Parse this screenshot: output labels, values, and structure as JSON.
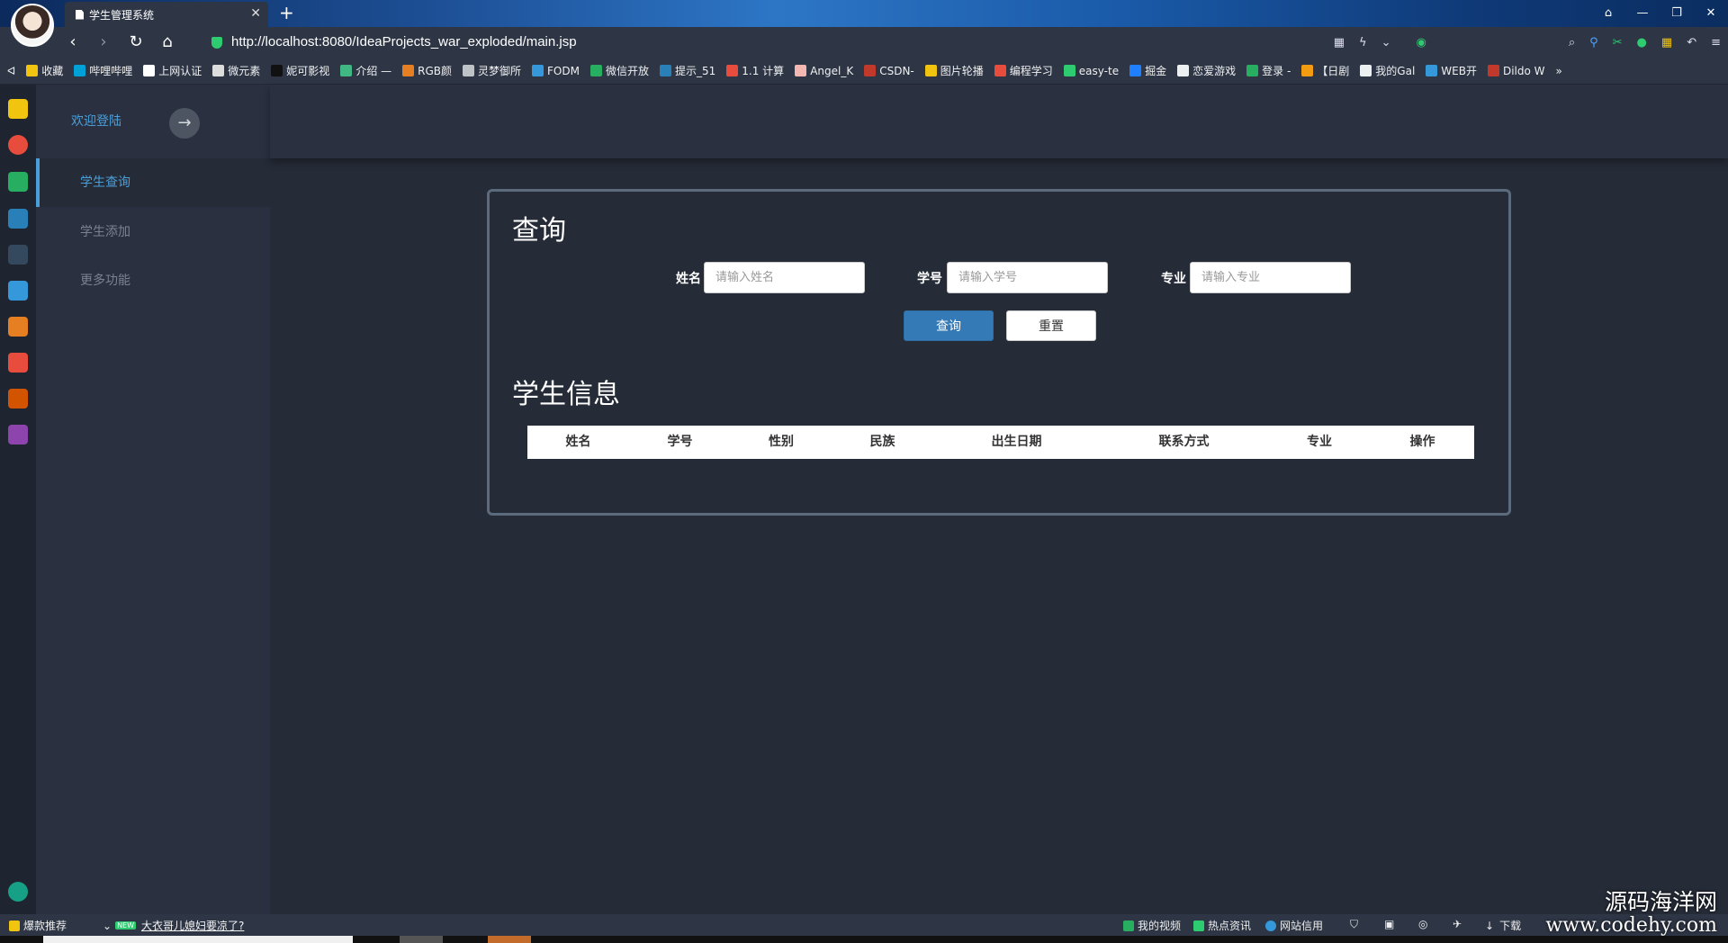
{
  "browser": {
    "tab_title": "学生管理系统",
    "tab_close": "✕",
    "new_tab": "+",
    "url": "http://localhost:8080/IdeaProjects_war_exploded/main.jsp",
    "window_controls": [
      "⌂",
      "—",
      "❐",
      "✕"
    ],
    "bookmarks_toggle": "ᐊ",
    "bookmarks": [
      {
        "label": "收藏",
        "color": "#f1c40f"
      },
      {
        "label": "哔哩哔哩",
        "color": "#00a1d6"
      },
      {
        "label": "上网认证",
        "color": "#ffffff"
      },
      {
        "label": "微元素",
        "color": "#dddddd"
      },
      {
        "label": "妮可影视",
        "color": "#111111"
      },
      {
        "label": "介绍 —",
        "color": "#41b883"
      },
      {
        "label": "RGB颜",
        "color": "#e67e22"
      },
      {
        "label": "灵梦御所",
        "color": "#bdc3c7"
      },
      {
        "label": "FODM",
        "color": "#3498db"
      },
      {
        "label": "微信开放",
        "color": "#27ae60"
      },
      {
        "label": "提示_51",
        "color": "#2980b9"
      },
      {
        "label": "1.1 计算",
        "color": "#e74c3c"
      },
      {
        "label": "Angel_K",
        "color": "#f5b7b1"
      },
      {
        "label": "CSDN-",
        "color": "#c0392b"
      },
      {
        "label": "图片轮播",
        "color": "#f1c40f"
      },
      {
        "label": "编程学习",
        "color": "#e74c3c"
      },
      {
        "label": "easy-te",
        "color": "#2ecc71"
      },
      {
        "label": "掘金",
        "color": "#1e80ff"
      },
      {
        "label": "恋爱游戏",
        "color": "#ecf0f1"
      },
      {
        "label": "登录 -",
        "color": "#27ae60"
      },
      {
        "label": "【日剧",
        "color": "#f39c12"
      },
      {
        "label": "我的Gal",
        "color": "#ecf0f1"
      },
      {
        "label": "WEB开",
        "color": "#3498db"
      },
      {
        "label": "Dildo W",
        "color": "#c0392b"
      }
    ],
    "bookmarks_more": "»"
  },
  "app": {
    "welcome": "欢迎登陆",
    "arrow": "→",
    "menu": [
      {
        "label": "学生查询",
        "active": true
      },
      {
        "label": "学生添加",
        "active": false
      },
      {
        "label": "更多功能",
        "active": false
      }
    ],
    "query": {
      "title": "查询",
      "fields": [
        {
          "label": "姓名",
          "placeholder": "请输入姓名",
          "value": ""
        },
        {
          "label": "学号",
          "placeholder": "请输入学号",
          "value": ""
        },
        {
          "label": "专业",
          "placeholder": "请输入专业",
          "value": ""
        }
      ],
      "query_button": "查询",
      "reset_button": "重置"
    },
    "table": {
      "title": "学生信息",
      "columns": [
        "姓名",
        "学号",
        "性别",
        "民族",
        "出生日期",
        "联系方式",
        "专业",
        "操作"
      ],
      "rows": []
    }
  },
  "statusbar": {
    "hot": "爆款推荐",
    "new_badge": "NEW",
    "news": "大衣哥儿媳妇要凉了?",
    "right_items": [
      "我的视频",
      "热点资讯",
      "网站信用",
      "下载"
    ]
  },
  "watermark": {
    "line1": "源码海洋网",
    "line2": "www.codehy.com"
  },
  "colors": {
    "accent": "#4a9fd8",
    "background": "#252b37",
    "sidebar": "#2a3040",
    "primary_button": "#337ab7"
  }
}
